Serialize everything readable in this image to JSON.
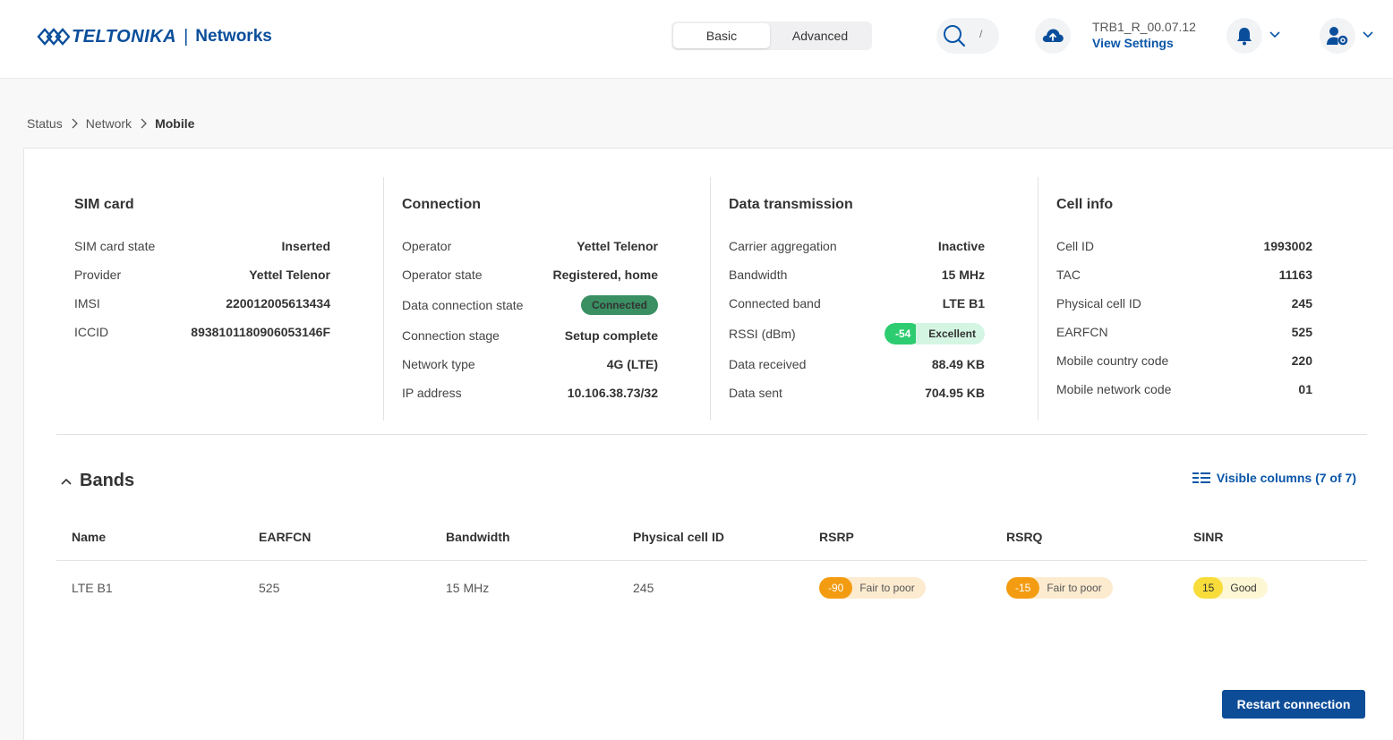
{
  "header": {
    "brand": "TELTONIKA",
    "brand_sep": "|",
    "brand_sub": "Networks",
    "mode_basic": "Basic",
    "mode_advanced": "Advanced",
    "search_shortcut": "/",
    "firmware_version": "TRB1_R_00.07.12",
    "view_settings": "View Settings",
    "brand_color": "#0a4e9b"
  },
  "breadcrumb": {
    "items": [
      "Status",
      "Network",
      "Mobile"
    ]
  },
  "sim_card": {
    "title": "SIM card",
    "rows": [
      {
        "label": "SIM card state",
        "value": "Inserted"
      },
      {
        "label": "Provider",
        "value": "Yettel Telenor"
      },
      {
        "label": "IMSI",
        "value": "220012005613434"
      },
      {
        "label": "ICCID",
        "value": "8938101180906053146F"
      }
    ]
  },
  "connection": {
    "title": "Connection",
    "rows": [
      {
        "label": "Operator",
        "value": "Yettel Telenor"
      },
      {
        "label": "Operator state",
        "value": "Registered, home"
      },
      {
        "label": "Data connection state",
        "value": "Connected"
      },
      {
        "label": "Connection stage",
        "value": "Setup complete"
      },
      {
        "label": "Network type",
        "value": "4G (LTE)"
      },
      {
        "label": "IP address",
        "value": "10.106.38.73/32"
      }
    ]
  },
  "data_transmission": {
    "title": "Data transmission",
    "rows": [
      {
        "label": "Carrier aggregation",
        "value": "Inactive"
      },
      {
        "label": "Bandwidth",
        "value": "15 MHz"
      },
      {
        "label": "Connected band",
        "value": "LTE B1"
      },
      {
        "label": "RSSI (dBm)",
        "value": "-54",
        "quality": "Excellent"
      },
      {
        "label": "Data received",
        "value": "88.49 KB"
      },
      {
        "label": "Data sent",
        "value": "704.95 KB"
      }
    ]
  },
  "cell_info": {
    "title": "Cell info",
    "rows": [
      {
        "label": "Cell ID",
        "value": "1993002"
      },
      {
        "label": "TAC",
        "value": "11163"
      },
      {
        "label": "Physical cell ID",
        "value": "245"
      },
      {
        "label": "EARFCN",
        "value": "525"
      },
      {
        "label": "Mobile country code",
        "value": "220"
      },
      {
        "label": "Mobile network code",
        "value": "01"
      }
    ]
  },
  "bands": {
    "title": "Bands",
    "visible_columns": "Visible columns (7 of 7)",
    "columns": [
      "Name",
      "EARFCN",
      "Bandwidth",
      "Physical cell ID",
      "RSRP",
      "RSRQ",
      "SINR"
    ],
    "rows": [
      {
        "name": "LTE B1",
        "earfcn": "525",
        "bandwidth": "15 MHz",
        "pci": "245",
        "rsrp": "-90",
        "rsrp_quality": "Fair to poor",
        "rsrq": "-15",
        "rsrq_quality": "Fair to poor",
        "sinr": "15",
        "sinr_quality": "Good"
      }
    ]
  },
  "actions": {
    "restart": "Restart connection"
  },
  "colors": {
    "connected": "#3a8f63",
    "excellent": "#2ecc71",
    "fair": "#f39c12",
    "good": "#f7dc3a",
    "primary_button": "#0d4d98"
  }
}
